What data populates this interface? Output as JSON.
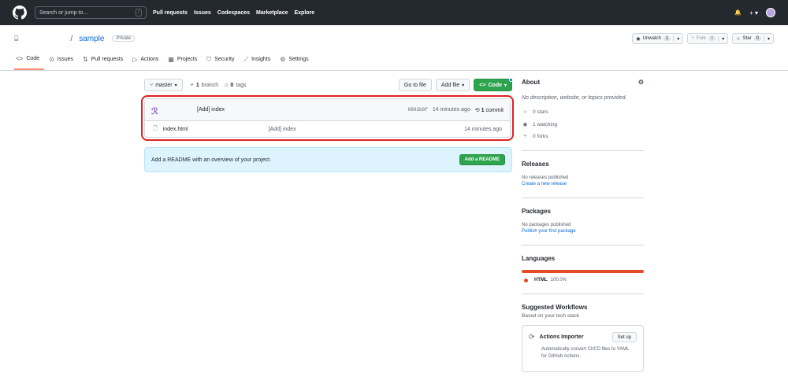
{
  "topbar": {
    "search_placeholder": "Search or jump to...",
    "slash": "/",
    "nav": [
      "Pull requests",
      "Issues",
      "Codespaces",
      "Marketplace",
      "Explore"
    ],
    "bell": "🔔",
    "plus": "+ ▾"
  },
  "repo": {
    "slash": "/",
    "name": "sample",
    "visibility": "Private",
    "unwatch_label": "Unwatch",
    "unwatch_count": "1",
    "fork_label": "Fork",
    "fork_count": "0",
    "star_label": "Star",
    "star_count": "0"
  },
  "tabs": [
    {
      "icon": "<>",
      "label": "Code"
    },
    {
      "icon": "⊙",
      "label": "Issues"
    },
    {
      "icon": "⇅",
      "label": "Pull requests"
    },
    {
      "icon": "▷",
      "label": "Actions"
    },
    {
      "icon": "▦",
      "label": "Projects"
    },
    {
      "icon": "⛉",
      "label": "Security"
    },
    {
      "icon": "⟋",
      "label": "Insights"
    },
    {
      "icon": "⚙",
      "label": "Settings"
    }
  ],
  "toolbar": {
    "branch": "master",
    "branch_count": "1",
    "branch_word": "branch",
    "tag_count": "0",
    "tag_word": "tags",
    "go_to_file": "Go to file",
    "add_file": "Add file",
    "code": "Code"
  },
  "commit": {
    "message": "[Add] index",
    "sha": "6802b0f",
    "time": "14 minutes ago",
    "count": "1",
    "count_word": "commit"
  },
  "files": [
    {
      "name": "index.html",
      "message": "[Add] index",
      "time": "14 minutes ago"
    }
  ],
  "readme": {
    "text": "Add a README with an overview of your project.",
    "button": "Add a README"
  },
  "about": {
    "title": "About",
    "description": "No description, website, or topics provided.",
    "stars": "0 stars",
    "watching": "1 watching",
    "forks": "0 forks"
  },
  "releases": {
    "title": "Releases",
    "text": "No releases published",
    "link": "Create a new release"
  },
  "packages": {
    "title": "Packages",
    "text": "No packages published",
    "link": "Publish your first package"
  },
  "languages": {
    "title": "Languages",
    "name": "HTML",
    "percent": "100.0%",
    "color": "#e34c26"
  },
  "workflows": {
    "title": "Suggested Workflows",
    "subtitle": "Based on your tech stack",
    "card_title": "Actions Importer",
    "card_button": "Set up",
    "card_desc_1": "Automatically convert CI/CD files to YAML",
    "card_desc_2": "for GitHub Actions."
  }
}
